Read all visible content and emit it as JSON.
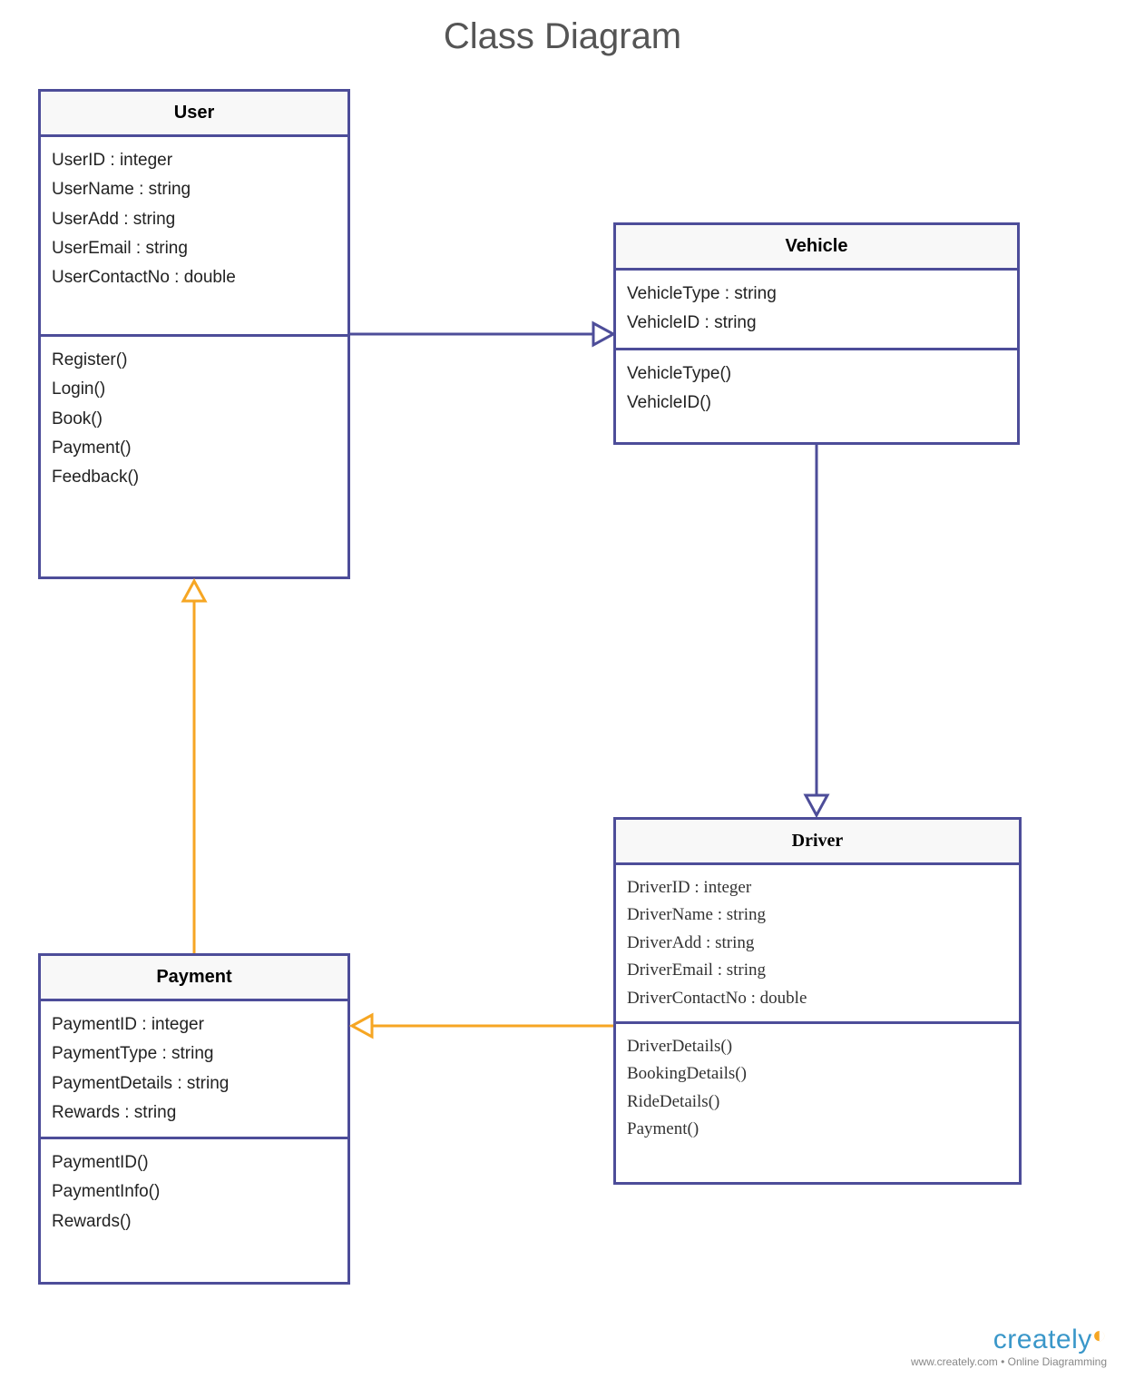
{
  "title": "Class Diagram",
  "classes": {
    "user": {
      "name": "User",
      "attributes": [
        "UserID : integer",
        "UserName : string",
        "UserAdd : string",
        "UserEmail : string",
        "UserContactNo : double"
      ],
      "methods": [
        "Register()",
        "Login()",
        "Book()",
        "Payment()",
        "Feedback()"
      ]
    },
    "vehicle": {
      "name": "Vehicle",
      "attributes": [
        "VehicleType : string",
        "VehicleID : string"
      ],
      "methods": [
        "VehicleType()",
        "VehicleID()"
      ]
    },
    "driver": {
      "name": "Driver",
      "attributes": [
        "DriverID :  integer",
        "DriverName : string",
        "DriverAdd : string",
        "DriverEmail : string",
        "DriverContactNo : double"
      ],
      "methods": [
        "DriverDetails()",
        "BookingDetails()",
        "RideDetails()",
        "Payment()"
      ]
    },
    "payment": {
      "name": "Payment",
      "attributes": [
        "PaymentID : integer",
        "PaymentType : string",
        "PaymentDetails : string",
        "Rewards : string"
      ],
      "methods": [
        "PaymentID()",
        "PaymentInfo()",
        "Rewards()"
      ]
    }
  },
  "relationships": [
    {
      "from": "User",
      "to": "Vehicle",
      "type": "inheritance",
      "color": "purple"
    },
    {
      "from": "Vehicle",
      "to": "Driver",
      "type": "inheritance",
      "color": "purple"
    },
    {
      "from": "Payment",
      "to": "User",
      "type": "inheritance",
      "color": "orange"
    },
    {
      "from": "Driver",
      "to": "Payment",
      "type": "inheritance",
      "color": "orange"
    }
  ],
  "footer": {
    "brand": "creately",
    "tagline": "www.creately.com • Online Diagramming"
  }
}
